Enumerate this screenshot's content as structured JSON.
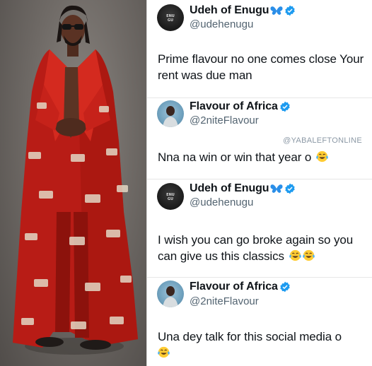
{
  "photo": {
    "alt_subject": "man-in-red-crown-patterned-coat"
  },
  "watermark": "@YABALEFTONLINE",
  "tweets": [
    {
      "name": "Udeh of Enugu",
      "handle": "@udehenugu",
      "avatar": "udeh",
      "avatar_text": "ENU\nGU",
      "name_emoji": "blue-butterfly-icon",
      "verified": true,
      "text": "Prime flavour no one comes close Your rent was due man",
      "laugh_emojis": 0
    },
    {
      "name": "Flavour of Africa",
      "handle": "@2niteFlavour",
      "avatar": "flavour",
      "verified": true,
      "text": "Nna na win or win that year o",
      "laugh_emojis": 1
    },
    {
      "name": "Udeh of Enugu",
      "handle": "@udehenugu",
      "avatar": "udeh",
      "avatar_text": "ENU\nGU",
      "name_emoji": "blue-butterfly-icon",
      "verified": true,
      "text": "I wish you can go broke again so you can give us this classics",
      "laugh_emojis": 2
    },
    {
      "name": "Flavour of Africa",
      "handle": "@2niteFlavour",
      "avatar": "flavour",
      "verified": true,
      "text": "Una dey talk for this social media o",
      "laugh_emojis": 1
    }
  ],
  "colors": {
    "verified_blue": "#1d9bf0",
    "text": "#0f1419",
    "handle": "#536471",
    "coat_red": "#c0201a"
  }
}
